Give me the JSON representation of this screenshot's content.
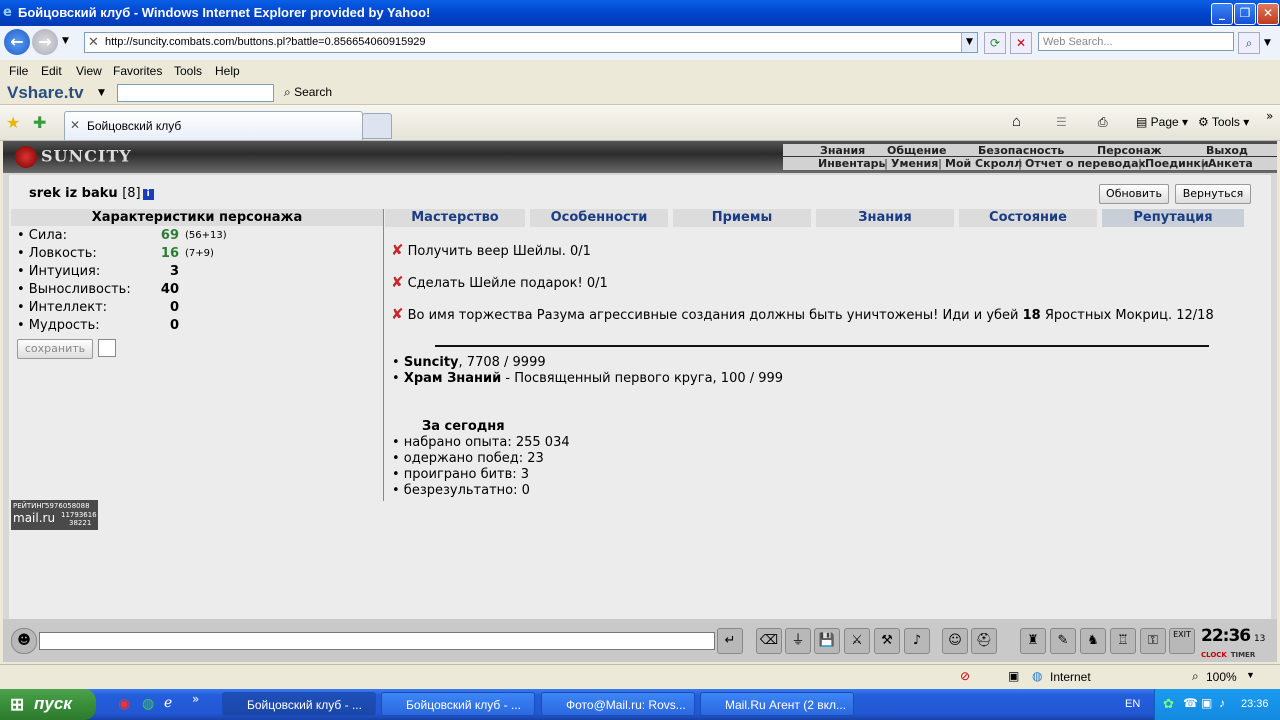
{
  "window": {
    "title": "Бойцовский клуб - Windows Internet Explorer provided by Yahoo!"
  },
  "address": {
    "url": "http://suncity.combats.com/buttons.pl?battle=0.856654060915929",
    "search_placeholder": "Web Search..."
  },
  "menu": [
    "File",
    "Edit",
    "View",
    "Favorites",
    "Tools",
    "Help"
  ],
  "vshare": {
    "logo": "Vshare.tv",
    "search_label": "Search"
  },
  "browser_tab": {
    "title": "Бойцовский клуб"
  },
  "commands": {
    "page": "Page",
    "tools": "Tools"
  },
  "site": {
    "logo": "SUNCITY",
    "top_menu_1": [
      "Знания",
      "Общение",
      "Безопасность",
      "Персонаж",
      "Выход"
    ],
    "top_menu_2": [
      "Инвентарь",
      "Умения",
      "Мой Скролл",
      "Отчет о переводах",
      "Поединки",
      "Анкета"
    ]
  },
  "character": {
    "name": "srek iz baku",
    "level": "[8]",
    "info_icon": "i"
  },
  "buttons": {
    "refresh": "Обновить",
    "back": "Вернуться",
    "save": "сохранить"
  },
  "stats": {
    "header": "Характеристики персонажа",
    "items": [
      {
        "label": "• Сила:",
        "value": "69",
        "extra": "(56+13)"
      },
      {
        "label": "• Ловкость:",
        "value": "16",
        "extra": "(7+9)"
      },
      {
        "label": "• Интуиция:",
        "value": "3",
        "extra": ""
      },
      {
        "label": "• Выносливость:",
        "value": "40",
        "extra": ""
      },
      {
        "label": "• Интеллект:",
        "value": "0",
        "extra": ""
      },
      {
        "label": "• Мудрость:",
        "value": "0",
        "extra": ""
      }
    ]
  },
  "tabs": [
    "Мастерство",
    "Особенности",
    "Приемы",
    "Знания",
    "Состояние",
    "Репутация"
  ],
  "quests": [
    {
      "text": "Получить веер Шейлы. 0/1"
    },
    {
      "text": "Сделать Шейле подарок! 0/1"
    },
    {
      "prefix": "Во имя торжества Разума агрессивные создания должны быть уничтожены! Иди и убей ",
      "bold": "18",
      "suffix": " Яростных Мокриц. 12/18"
    }
  ],
  "reputation": [
    {
      "name": "Suncity",
      "text": ", 7708 / 9999"
    },
    {
      "name": "Храм Знаний",
      "text": " - Посвященный первого круга, 100 / 999"
    }
  ],
  "today": {
    "title": "За сегодня",
    "items": [
      "• набрано опыта: 255 034",
      "• одержано побед: 23",
      "• проиграно битв: 3",
      "• безрезультатно: 0"
    ]
  },
  "rating_counter": {
    "label": "РЕЙТИНГ",
    "brand": "mail.ru",
    "n1": "5976058088",
    "n2": "11793616",
    "n3": "38221"
  },
  "clock": {
    "time": "22:36",
    "sec": "13",
    "label_clock": "CLOCK",
    "label_timer": "TIMER",
    "exit": "EXIT"
  },
  "statusbar": {
    "zone": "Internet",
    "zoom": "100%"
  },
  "taskbar": {
    "start": "пуск",
    "tasks": [
      "Бойцовский клуб - ...",
      "Бойцовский клуб - ...",
      "Фото@Mail.ru: Rovs...",
      "Mail.Ru Агент (2 вкл..."
    ],
    "lang": "EN",
    "time": "23:36"
  }
}
